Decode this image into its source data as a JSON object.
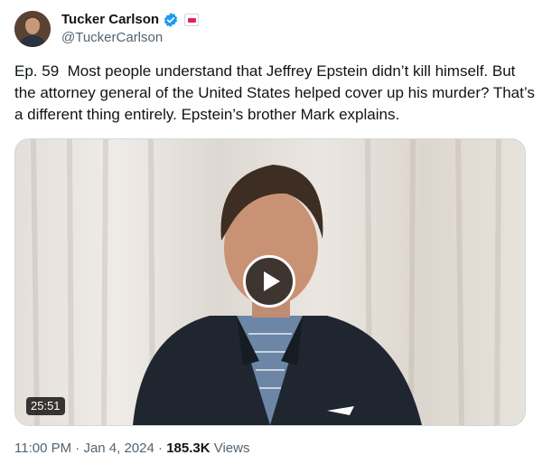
{
  "author": {
    "display_name": "Tucker Carlson",
    "handle": "@TuckerCarlson",
    "verified": true,
    "verified_color": "#1d9bf0"
  },
  "tweet": {
    "text": "Ep. 59  Most people understand that Jeffrey Epstein didn’t kill himself. But the attorney general of the United States helped cover up his murder? That’s a different thing entirely. Epstein’s brother Mark explains."
  },
  "media": {
    "type": "video",
    "duration": "25:51",
    "play_icon": "play-icon"
  },
  "meta": {
    "time": "11:00 PM",
    "separator": "·",
    "date": "Jan 4, 2024",
    "views_count": "185.3K",
    "views_label": "Views"
  }
}
